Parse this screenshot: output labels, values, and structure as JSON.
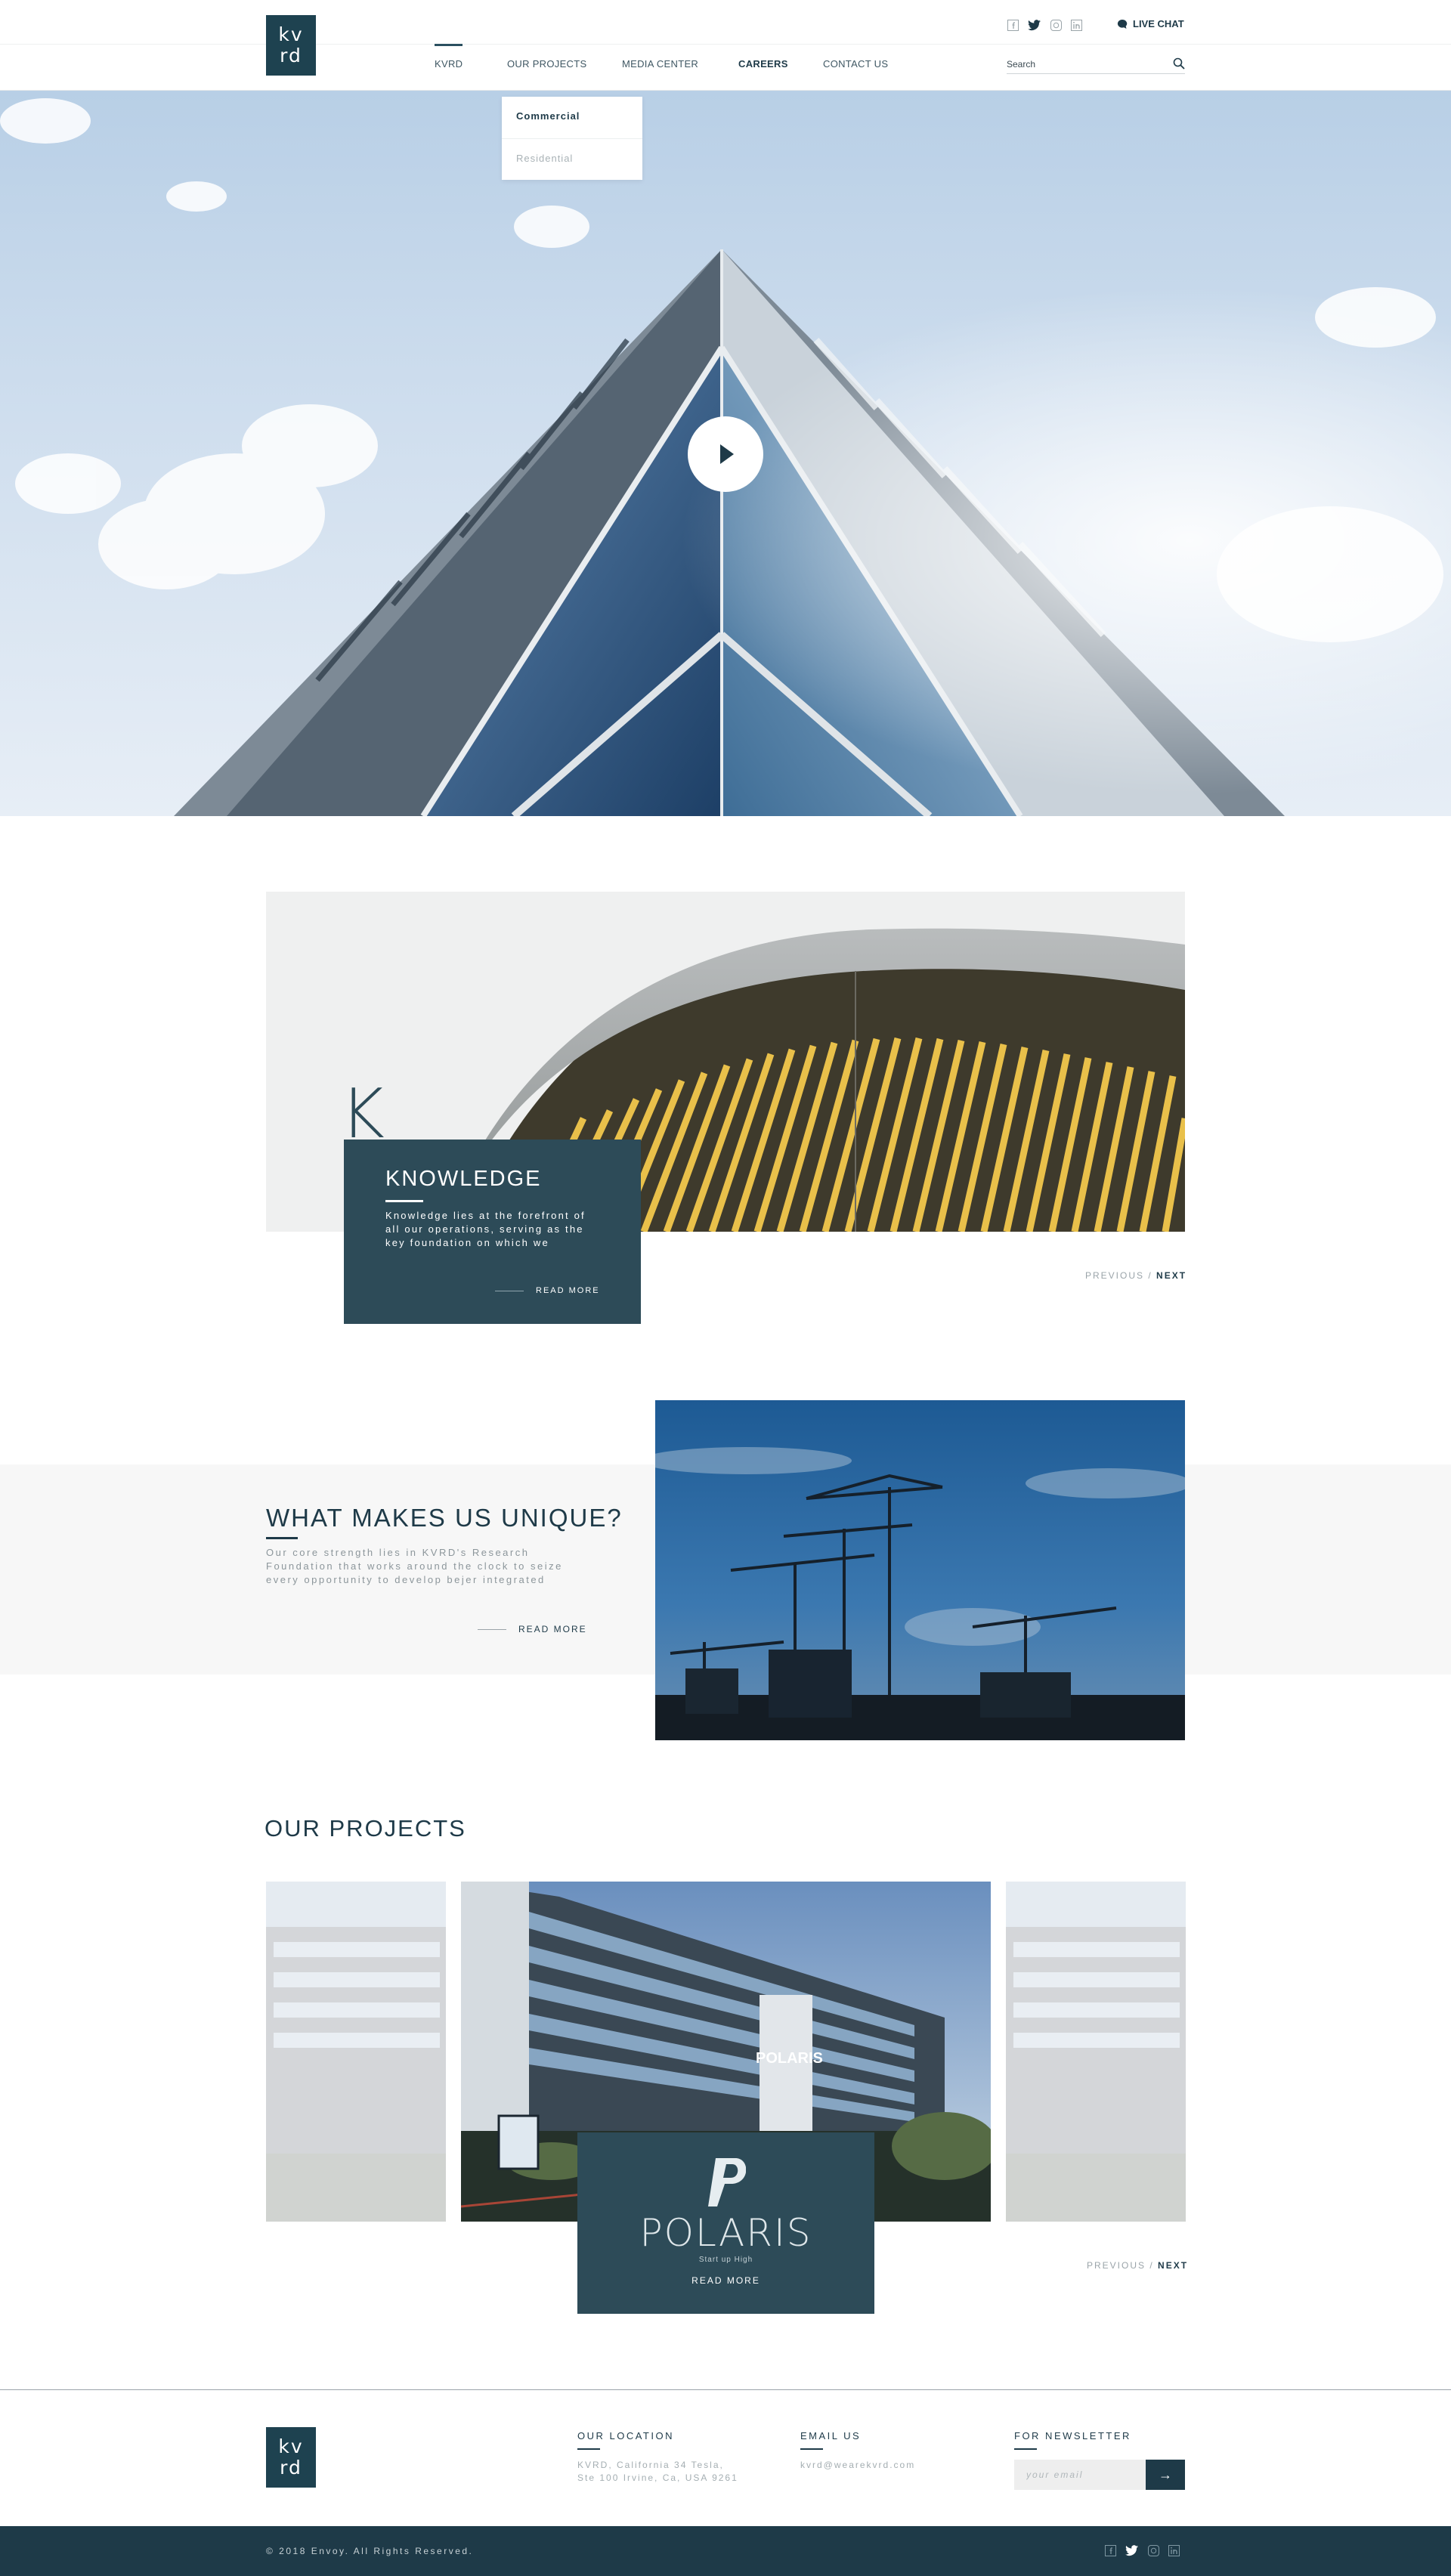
{
  "brand": {
    "logo_top": "kv",
    "logo_bottom": "rd",
    "accent": "#1e3a48",
    "card": "#2d4b58"
  },
  "header": {
    "social_icons": [
      "facebook-icon",
      "twitter-icon",
      "instagram-icon",
      "linkedin-icon"
    ],
    "live_chat": "LIVE CHAT",
    "nav": [
      {
        "label": "KVRD",
        "active": true
      },
      {
        "label": "OUR PROJECTS"
      },
      {
        "label": "MEDIA CENTER"
      },
      {
        "label": "CAREERS"
      },
      {
        "label": "CONTACT US"
      }
    ],
    "search_placeholder": "Search",
    "dropdown": [
      "Commercial",
      "Residential"
    ]
  },
  "knowledge": {
    "letter": "K",
    "title": "KNOWLEDGE",
    "text": "Knowledge lies at the forefront of all our operations, serving as the key foundation on which we",
    "read_more": "READ MORE",
    "previous": "PREVIOUS",
    "slash": "/",
    "next": "NEXT"
  },
  "unique": {
    "title": "WHAT MAKES US UNIQUE?",
    "text": "Our core strength lies in KVRD's Research Foundation that works around the clock to seize every opportunity to develop bejer integrated",
    "read_more": "READ MORE"
  },
  "projects": {
    "title": "OUR PROJECTS",
    "featured": {
      "name": "POLARIS",
      "tagline": "Start up High",
      "read_more": "READ MORE",
      "sign": "POLARIS"
    },
    "previous": "PREVIOUS",
    "slash": "/",
    "next": "NEXT"
  },
  "footer": {
    "location_heading": "OUR LOCATION",
    "location_line1": "KVRD, California 34 Tesla,",
    "location_line2": "Ste 100 Irvine, Ca, USA 9261",
    "email_heading": "EMAIL US",
    "email": "kvrd@wearekvrd.com",
    "newsletter_heading": "FOR NEWSLETTER",
    "newsletter_placeholder": "your email",
    "submit": "→",
    "copyright": "© 2018 Envoy. All Rights Reserved."
  }
}
